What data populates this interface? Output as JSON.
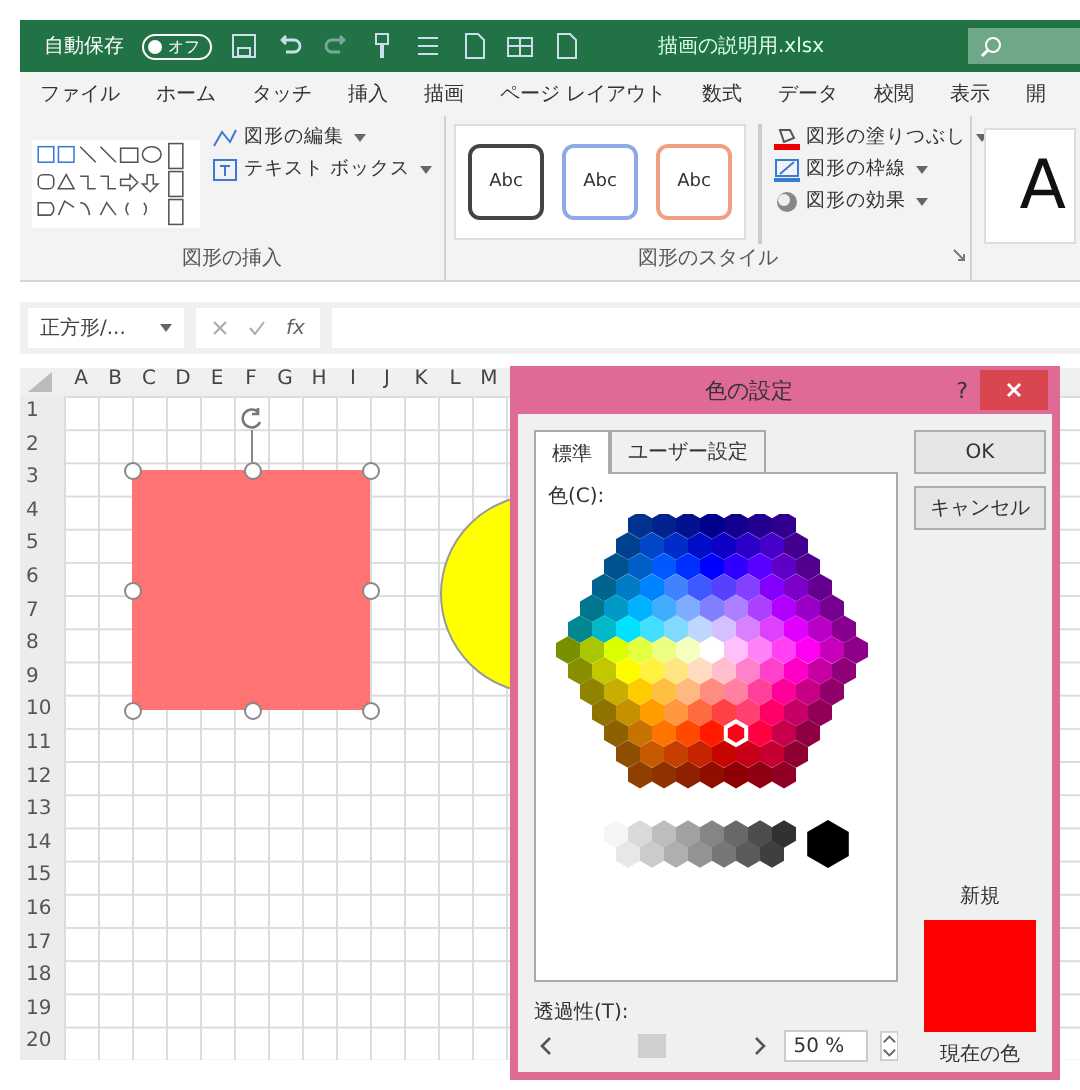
{
  "title_bar": {
    "autosave_label": "自動保存",
    "autosave_toggle": {
      "label": "オフ",
      "on": false
    },
    "filename": "描画の説明用.xlsx"
  },
  "ribbon_tabs": [
    "ファイル",
    "ホーム",
    "タッチ",
    "挿入",
    "描画",
    "ページ レイアウト",
    "数式",
    "データ",
    "校閲",
    "表示",
    "開"
  ],
  "ribbon": {
    "groups": [
      {
        "kind": "insert",
        "label": "図形の挿入",
        "buttons": [
          "図形の編集",
          "テキスト ボックス"
        ]
      },
      {
        "kind": "styles",
        "label": "図形のスタイル",
        "style_samples": [
          "Abc",
          "Abc",
          "Abc"
        ],
        "buttons": [
          "図形の塗りつぶし",
          "図形の枠線",
          "図形の効果"
        ]
      },
      {
        "kind": "wordart",
        "sample": "A"
      }
    ]
  },
  "formula_bar": {
    "name_box": "正方形/...",
    "fx": "fx"
  },
  "sheet": {
    "columns": [
      "A",
      "B",
      "C",
      "D",
      "E",
      "F",
      "G",
      "H",
      "I",
      "J",
      "K",
      "L",
      "M"
    ],
    "rows": [
      "1",
      "2",
      "3",
      "4",
      "5",
      "6",
      "7",
      "8",
      "9",
      "10",
      "11",
      "12",
      "13",
      "14",
      "15",
      "16",
      "17",
      "18",
      "19",
      "20"
    ],
    "shapes": [
      {
        "kind": "rectangle",
        "color": "#ff7373",
        "selected": true
      },
      {
        "kind": "ellipse",
        "color": "#ffff00",
        "selected": false
      }
    ]
  },
  "dialog": {
    "title": "色の設定",
    "help": "?",
    "tabs": [
      {
        "label": "標準",
        "selected": true
      },
      {
        "label": "ユーザー設定",
        "selected": false
      }
    ],
    "colors_label": "色(C):",
    "ok": "OK",
    "cancel": "キャンセル",
    "swatches": [
      {
        "label": "新規",
        "color": "#ff0000"
      },
      {
        "label": "現在の色",
        "color": "#ff0000"
      }
    ],
    "transparency_label": "透過性(T):",
    "transparency": {
      "level": 0.45,
      "value": "50 %"
    }
  }
}
